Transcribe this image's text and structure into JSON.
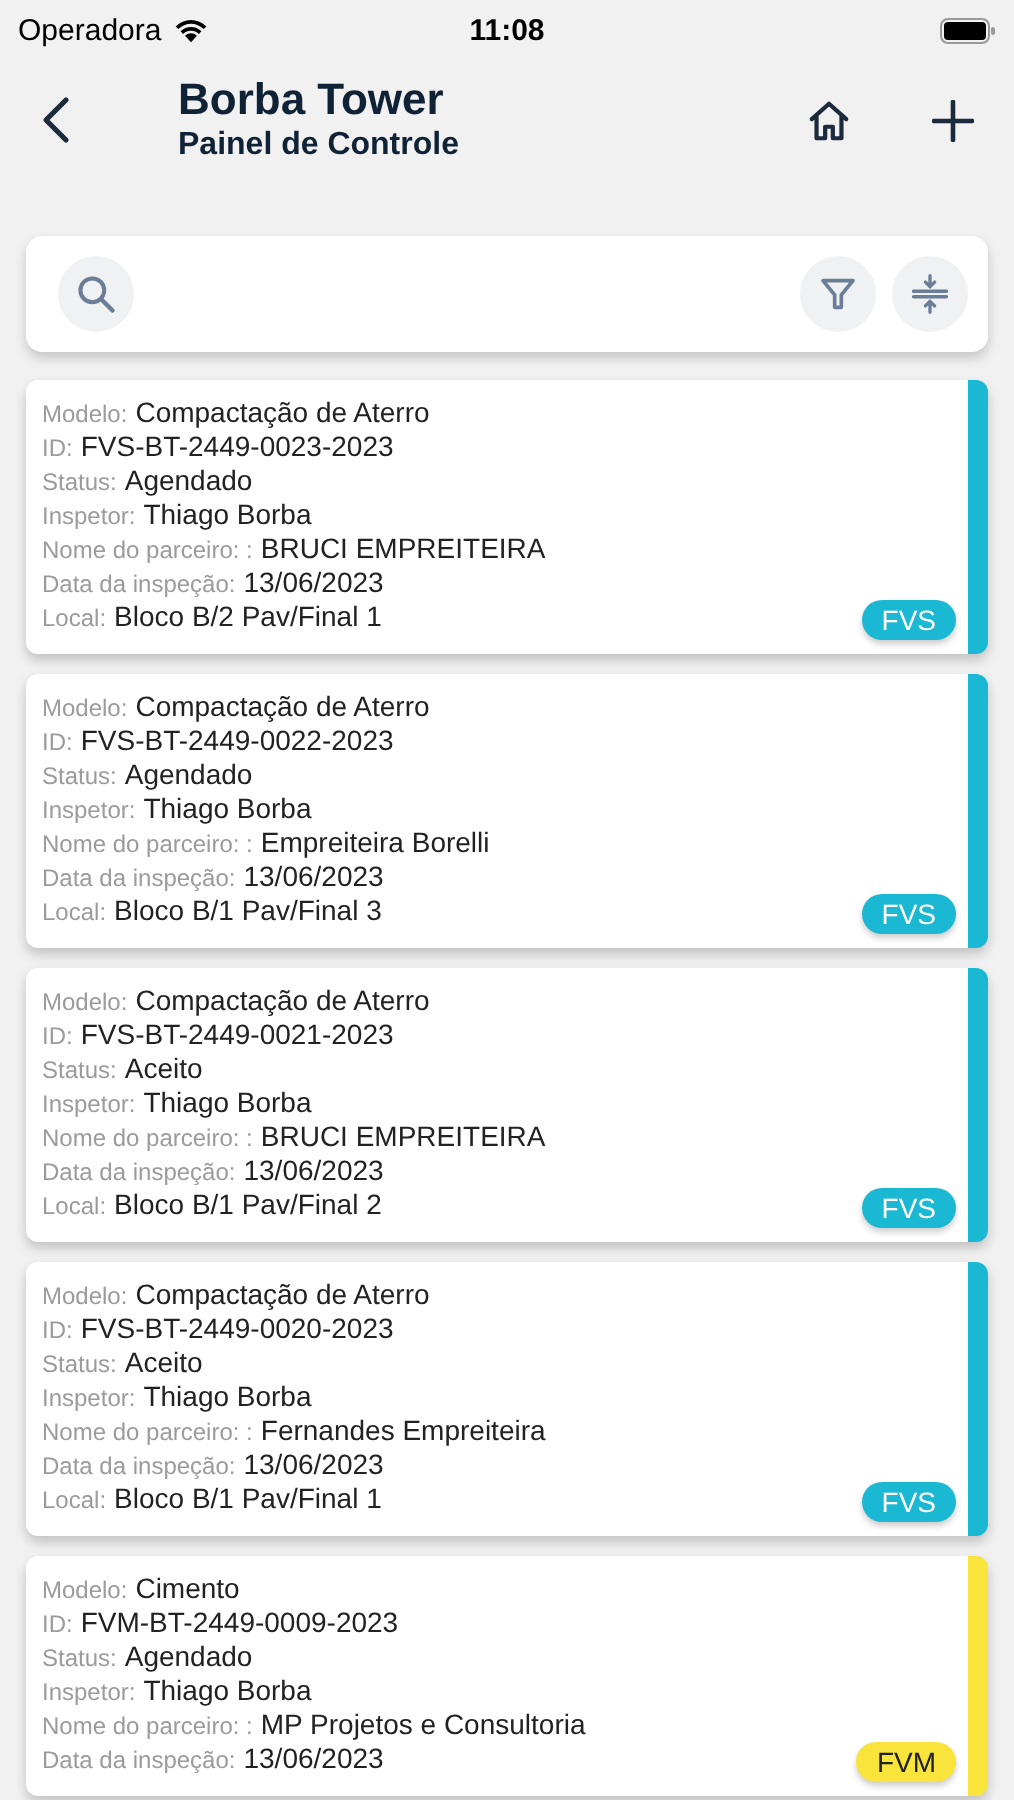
{
  "status_bar": {
    "carrier": "Operadora",
    "time": "11:08"
  },
  "header": {
    "title": "Borba Tower",
    "subtitle": "Painel de Controle"
  },
  "cards": [
    {
      "color": "#1ab8d2",
      "tag": "FVS",
      "fields": [
        {
          "label": "Modelo:",
          "value": "Compactação de Aterro"
        },
        {
          "label": "ID:",
          "value": "FVS-BT-2449-0023-2023"
        },
        {
          "label": "Status:",
          "value": "Agendado"
        },
        {
          "label": "Inspetor:",
          "value": "Thiago Borba"
        },
        {
          "label": "Nome do parceiro: :",
          "value": "BRUCI EMPREITEIRA"
        },
        {
          "label": "Data da inspeção:",
          "value": "13/06/2023"
        },
        {
          "label": "Local:",
          "value": "Bloco B/2 Pav/Final 1"
        }
      ]
    },
    {
      "color": "#1ab8d2",
      "tag": "FVS",
      "fields": [
        {
          "label": "Modelo:",
          "value": "Compactação de Aterro"
        },
        {
          "label": "ID:",
          "value": "FVS-BT-2449-0022-2023"
        },
        {
          "label": "Status:",
          "value": "Agendado"
        },
        {
          "label": "Inspetor:",
          "value": "Thiago Borba"
        },
        {
          "label": "Nome do parceiro: :",
          "value": "Empreiteira Borelli"
        },
        {
          "label": "Data da inspeção:",
          "value": "13/06/2023"
        },
        {
          "label": "Local:",
          "value": "Bloco B/1 Pav/Final 3"
        }
      ]
    },
    {
      "color": "#1ab8d2",
      "tag": "FVS",
      "fields": [
        {
          "label": "Modelo:",
          "value": "Compactação de Aterro"
        },
        {
          "label": "ID:",
          "value": "FVS-BT-2449-0021-2023"
        },
        {
          "label": "Status:",
          "value": "Aceito"
        },
        {
          "label": "Inspetor:",
          "value": "Thiago Borba"
        },
        {
          "label": "Nome do parceiro: :",
          "value": "BRUCI EMPREITEIRA"
        },
        {
          "label": "Data da inspeção:",
          "value": "13/06/2023"
        },
        {
          "label": "Local:",
          "value": "Bloco B/1 Pav/Final 2"
        }
      ]
    },
    {
      "color": "#1ab8d2",
      "tag": "FVS",
      "fields": [
        {
          "label": "Modelo:",
          "value": "Compactação de Aterro"
        },
        {
          "label": "ID:",
          "value": "FVS-BT-2449-0020-2023"
        },
        {
          "label": "Status:",
          "value": "Aceito"
        },
        {
          "label": "Inspetor:",
          "value": "Thiago Borba"
        },
        {
          "label": "Nome do parceiro: :",
          "value": "Fernandes Empreiteira"
        },
        {
          "label": "Data da inspeção:",
          "value": "13/06/2023"
        },
        {
          "label": "Local:",
          "value": "Bloco B/1 Pav/Final 1"
        }
      ]
    },
    {
      "color": "#f8e43a",
      "tag": "FVM",
      "fields": [
        {
          "label": "Modelo:",
          "value": "Cimento"
        },
        {
          "label": "ID:",
          "value": "FVM-BT-2449-0009-2023"
        },
        {
          "label": "Status:",
          "value": "Agendado"
        },
        {
          "label": "Inspetor:",
          "value": "Thiago Borba"
        },
        {
          "label": "Nome do parceiro: :",
          "value": "MP Projetos e Consultoria"
        },
        {
          "label": "Data da inspeção:",
          "value": "13/06/2023"
        }
      ]
    }
  ]
}
